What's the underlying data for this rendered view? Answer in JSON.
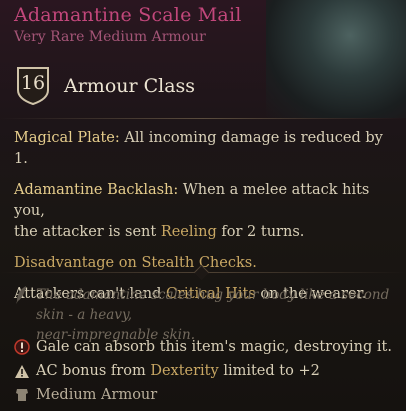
{
  "item": {
    "name": "Adamantine Scale Mail",
    "subtitle": "Very Rare Medium Armour",
    "armour_class": {
      "value": "16",
      "label": "Armour Class"
    }
  },
  "effects": {
    "magical_plate": {
      "name": "Magical Plate:",
      "text": "All incoming damage is reduced by 1."
    },
    "backlash": {
      "name": "Adamantine Backlash:",
      "line1": "When a melee attack hits you,",
      "line2_prefix": "the attacker is sent ",
      "line2_keyword": "Reeling",
      "line2_suffix": " for 2 turns."
    },
    "stealth": {
      "keyword": "Disadvantage",
      "middle": " on ",
      "keyword2": "Stealth Checks",
      "suffix": "."
    },
    "critical": {
      "prefix": "Attackers can't land ",
      "keyword": "Critical Hits",
      "suffix": " on the wearer."
    }
  },
  "flavor": {
    "line1": "The adamantine scales hug your body like a second skin - a heavy,",
    "line2": "near-impregnable skin."
  },
  "info": {
    "absorb": "Gale can absorb this item's magic, destroying it.",
    "dex_prefix": "AC bonus from ",
    "dex_keyword": "Dexterity",
    "dex_suffix": " limited to +2",
    "category": "Medium Armour"
  },
  "colors": {
    "title": "#c2477b",
    "keyword": "#c9a864",
    "warning": "#c0392b"
  }
}
